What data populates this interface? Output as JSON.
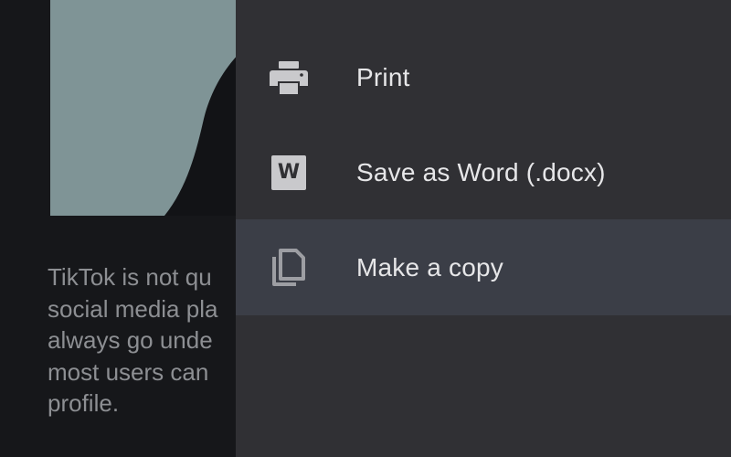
{
  "document": {
    "paragraph": "TikTok is not qu\nsocial media pla\nalways go unde\nmost users can\nprofile."
  },
  "menu": {
    "items": [
      {
        "label": "Print",
        "icon": "printer-icon"
      },
      {
        "label": "Save as Word (.docx)",
        "icon": "word-doc-icon",
        "badge": "W"
      },
      {
        "label": "Make a copy",
        "icon": "copy-icon",
        "highlighted": true
      }
    ]
  },
  "colors": {
    "menu_background": "#303034",
    "highlight": "#3b3e47",
    "doc_background": "#16171a",
    "icon": "#c9c9cc",
    "label": "#e6e6e8"
  }
}
